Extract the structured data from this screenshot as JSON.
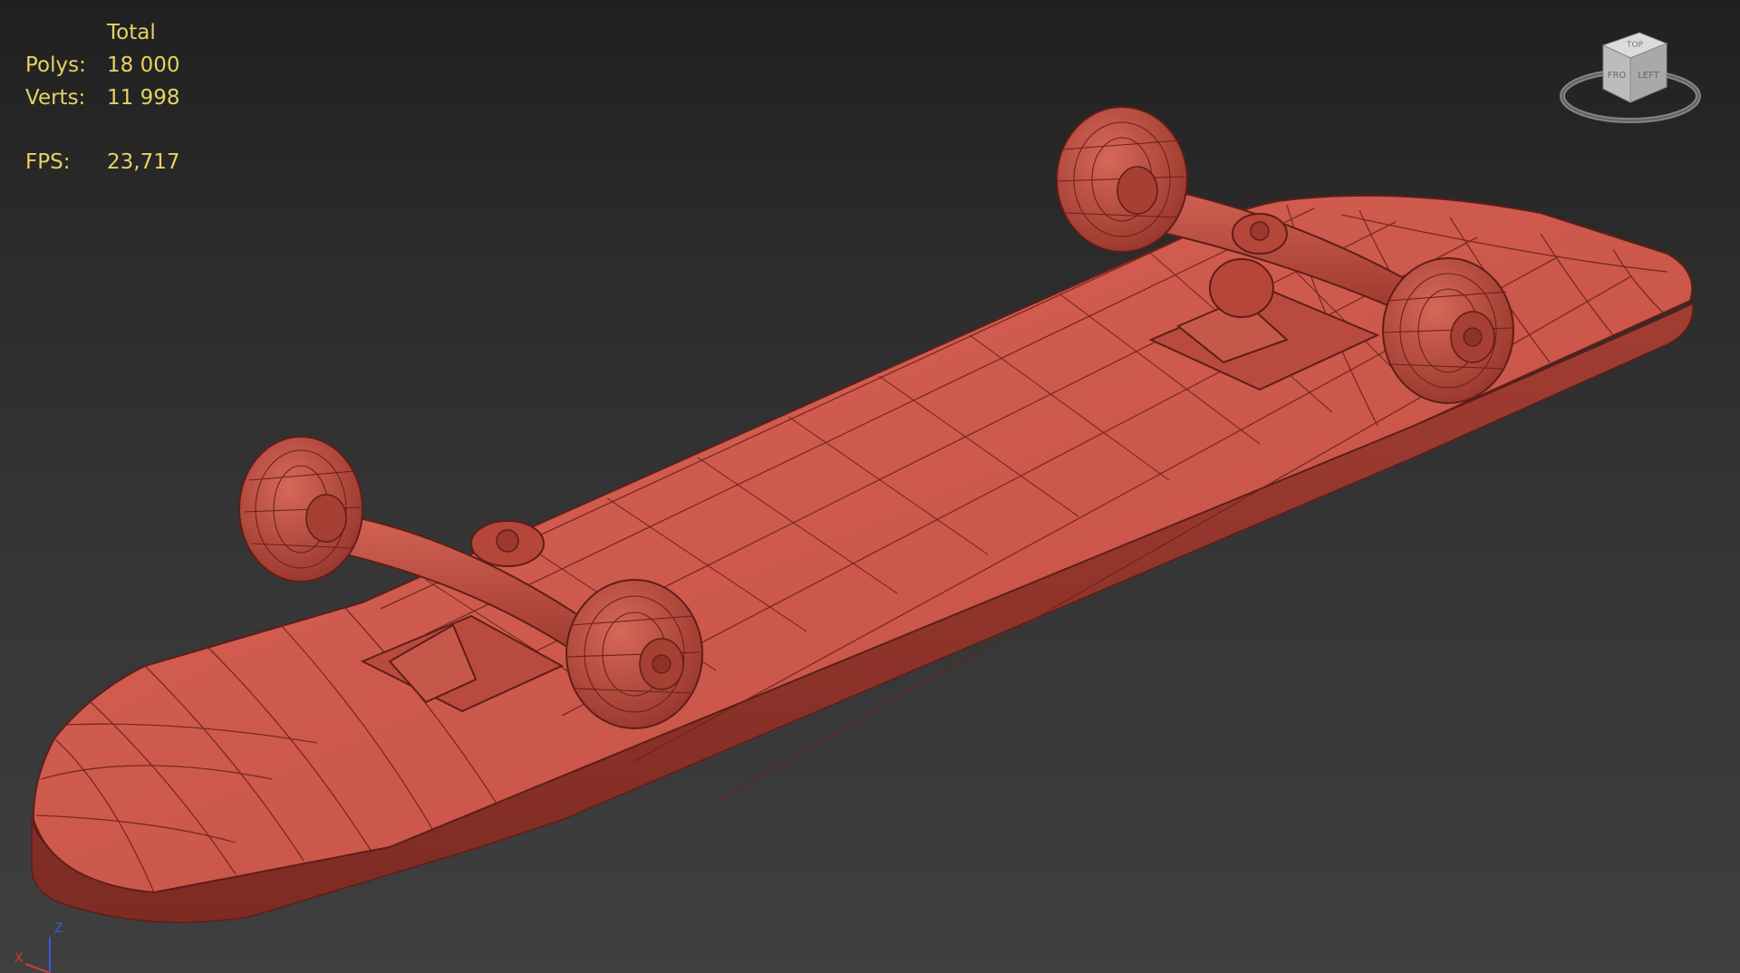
{
  "stats": {
    "header": "Total",
    "polys_label": "Polys:",
    "polys_value": "18 000",
    "verts_label": "Verts:",
    "verts_value": "11 998",
    "fps_label": "FPS:",
    "fps_value": "23,717"
  },
  "viewcube": {
    "face_top": "TOP",
    "face_front": "FRO",
    "face_left": "LEFT"
  },
  "axes": {
    "z": "Z",
    "x": "X"
  },
  "colors": {
    "stats_text": "#e6d264",
    "model_fill": "#c9574b",
    "wire": "#5e1e18",
    "axis_z": "#3a5ad6",
    "axis_x": "#d23c3c"
  },
  "icons": {
    "viewcube": "viewcube-icon",
    "axis": "axis-tripod-icon"
  }
}
